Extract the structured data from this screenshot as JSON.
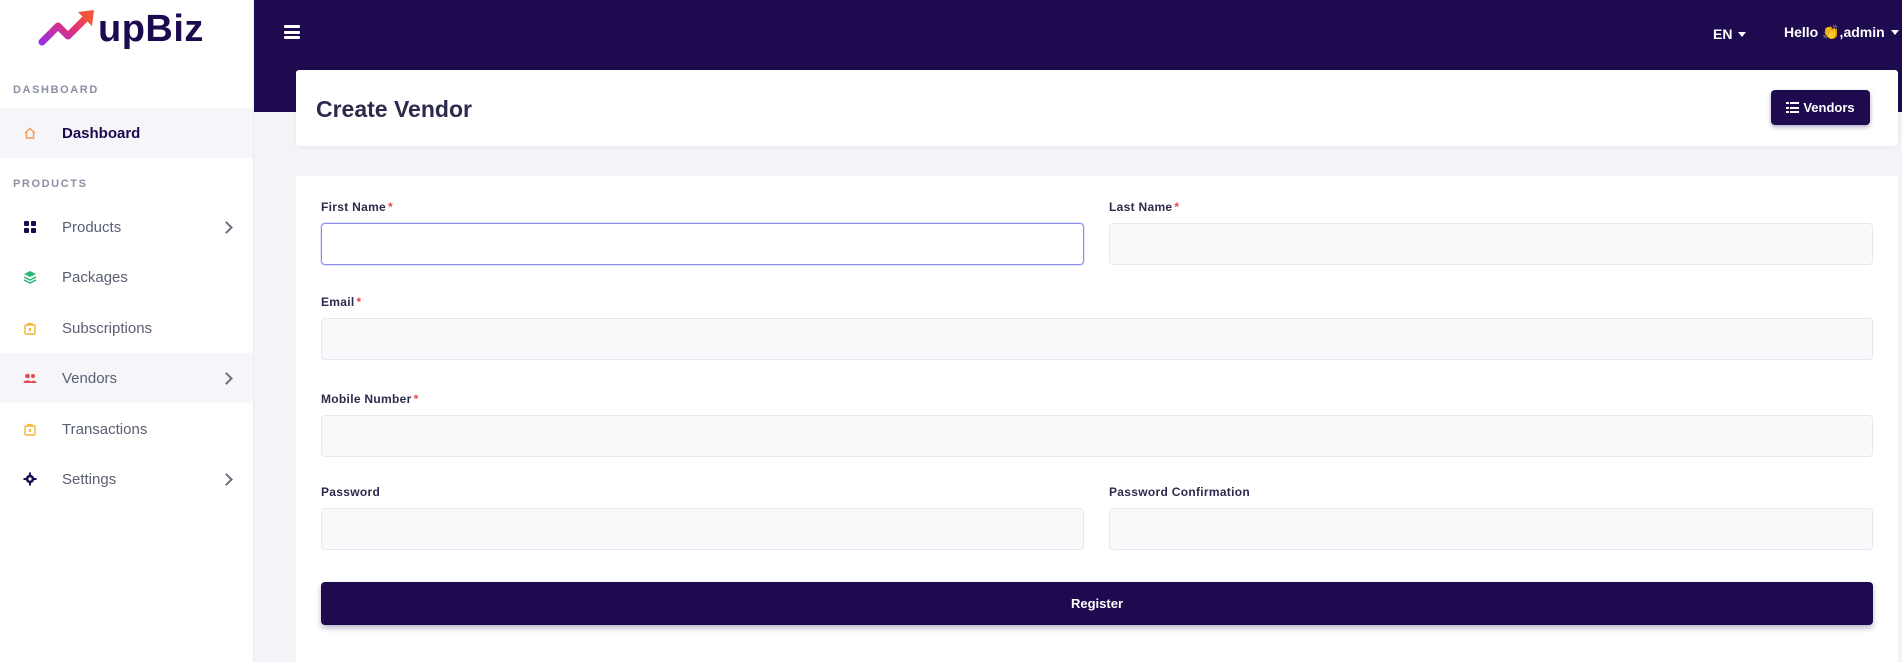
{
  "brand": {
    "name": "upBiz"
  },
  "sidebar": {
    "sections": [
      {
        "label": "DASHBOARD"
      },
      {
        "label": "PRODUCTS"
      }
    ],
    "items": [
      {
        "label": "Dashboard",
        "icon": "home-icon",
        "color": "#f29e4c",
        "active": true
      },
      {
        "label": "Products",
        "icon": "grid-icon",
        "color": "#1e0a4f",
        "chevron": true
      },
      {
        "label": "Packages",
        "icon": "layers-icon",
        "color": "#2bb673"
      },
      {
        "label": "Subscriptions",
        "icon": "bag-icon",
        "color": "#f2b632"
      },
      {
        "label": "Vendors",
        "icon": "users-icon",
        "color": "#e5484d",
        "chevron": true
      },
      {
        "label": "Transactions",
        "icon": "bag-icon",
        "color": "#f2b632"
      },
      {
        "label": "Settings",
        "icon": "gear-icon",
        "color": "#1e0a4f",
        "chevron": true
      }
    ]
  },
  "topbar": {
    "language": "EN",
    "greeting": "Hello 👏,admin"
  },
  "header": {
    "title": "Create Vendor",
    "vendors_button": "Vendors"
  },
  "form": {
    "first_name_label": "First Name",
    "last_name_label": "Last Name",
    "email_label": "Email",
    "mobile_label": "Mobile Number",
    "password_label": "Password",
    "password_confirmation_label": "Password Confirmation",
    "required_mark": "*",
    "first_name_value": "",
    "last_name_value": "",
    "email_value": "",
    "mobile_value": "",
    "password_value": "",
    "password_confirmation_value": "",
    "register_button": "Register"
  },
  "colors": {
    "primary": "#1e0a4f",
    "required": "#e5484d"
  }
}
